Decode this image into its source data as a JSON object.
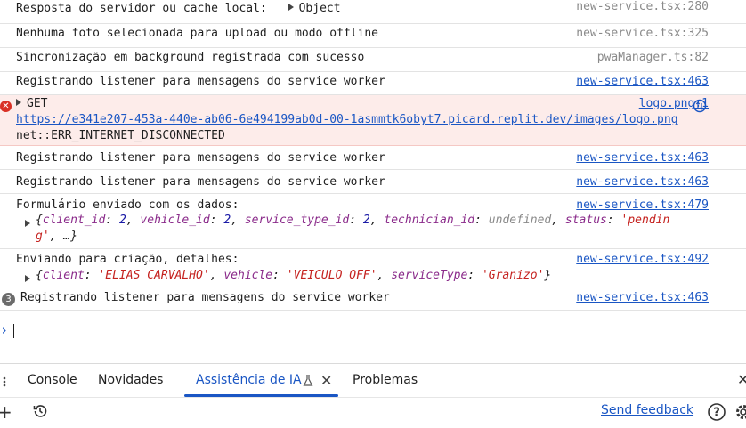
{
  "rows": [
    {
      "msg": "Resposta do servidor ou cache local:",
      "obj": "Object",
      "src": "new-service.tsx:280"
    },
    {
      "msg": "Nenhuma foto selecionada para upload ou modo offline",
      "src": "new-service.tsx:325"
    },
    {
      "msg": "Sincronização em background registrada com sucesso",
      "src": "pwaManager.ts:82"
    },
    {
      "msg": "Registrando listener para mensagens do service worker",
      "src": "new-service.tsx:463"
    }
  ],
  "error": {
    "method": "GET",
    "url": "https://e341e207-453a-440e-ab06-6e494199ab0d-00-1asmmtk6obyt7.picard.replit.dev/images/logo.png",
    "detail": "net::ERR_INTERNET_DISCONNECTED",
    "src": "logo.png:1"
  },
  "rows2": [
    {
      "msg": "Registrando listener para mensagens do service worker",
      "src": "new-service.tsx:463"
    },
    {
      "msg": "Registrando listener para mensagens do service worker",
      "src": "new-service.tsx:463"
    }
  ],
  "form": {
    "msg": "Formulário enviado com os dados:",
    "src": "new-service.tsx:479",
    "k1": "client_id",
    "v1": "2",
    "k2": "vehicle_id",
    "v2": "2",
    "k3": "service_type_id",
    "v3": "2",
    "k4": "technician_id",
    "v4": "undefined",
    "k5": "status",
    "v5a": "'pendin",
    "v5b": "g'"
  },
  "create": {
    "msg": "Enviando para criação, detalhes:",
    "src": "new-service.tsx:492",
    "k1": "client",
    "v1": "'ELIAS CARVALHO'",
    "k2": "vehicle",
    "v2": "'VEICULO OFF'",
    "k3": "serviceType",
    "v3": "'Granizo'"
  },
  "last": {
    "count": "3",
    "msg": "Registrando listener para mensagens do service worker",
    "src": "new-service.tsx:463"
  },
  "prompt": "›",
  "tabs": [
    "Console",
    "Novidades",
    "Assistência de IA",
    "Problemas"
  ],
  "feedback": "Send feedback",
  "colors": {
    "accent": "#1a56c4",
    "error_bg": "#fdecea",
    "error_icon": "#d93025"
  }
}
